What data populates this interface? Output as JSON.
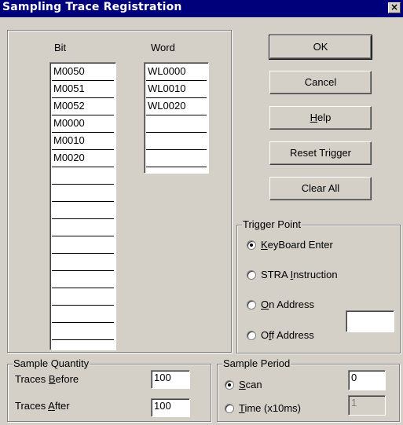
{
  "window": {
    "title": "Sampling Trace Registration",
    "close_glyph": "×"
  },
  "columns": {
    "bit_header": "Bit",
    "word_header": "Word"
  },
  "bit_cells": [
    "M0050",
    "M0051",
    "M0052",
    "M0000",
    "M0010",
    "M0020",
    "",
    "",
    "",
    "",
    "",
    "",
    "",
    "",
    "",
    "",
    ""
  ],
  "word_cells": [
    "WL0000",
    "WL0010",
    "WL0020",
    "",
    "",
    ""
  ],
  "buttons": {
    "ok": "OK",
    "cancel": "Cancel",
    "help_mn": "H",
    "help_rest": "elp",
    "reset_trigger": "Reset Trigger",
    "clear_all": "Clear All"
  },
  "trigger_point": {
    "label": "Trigger Point",
    "selected": "keyboard_enter",
    "keyboard": {
      "mn": "K",
      "rest": "eyBoard Enter"
    },
    "stra": {
      "pre": "STRA ",
      "mn": "I",
      "rest": "nstruction"
    },
    "on_address": {
      "mn": "O",
      "rest": "n Address"
    },
    "off_address": {
      "pre": "O",
      "mn": "f",
      "rest": "f Address"
    },
    "address_value": ""
  },
  "sample_quantity": {
    "label": "Sample Quantity",
    "before": {
      "pre": "Traces ",
      "mn": "B",
      "rest": "efore",
      "value": "100"
    },
    "after": {
      "pre": "Traces ",
      "mn": "A",
      "rest": "fter",
      "value": "100"
    }
  },
  "sample_period": {
    "label": "Sample Period",
    "selected": "scan",
    "scan": {
      "mn": "S",
      "rest": "can",
      "value": "0"
    },
    "time": {
      "mn": "T",
      "rest": "ime (x10ms)",
      "value": "1"
    }
  }
}
